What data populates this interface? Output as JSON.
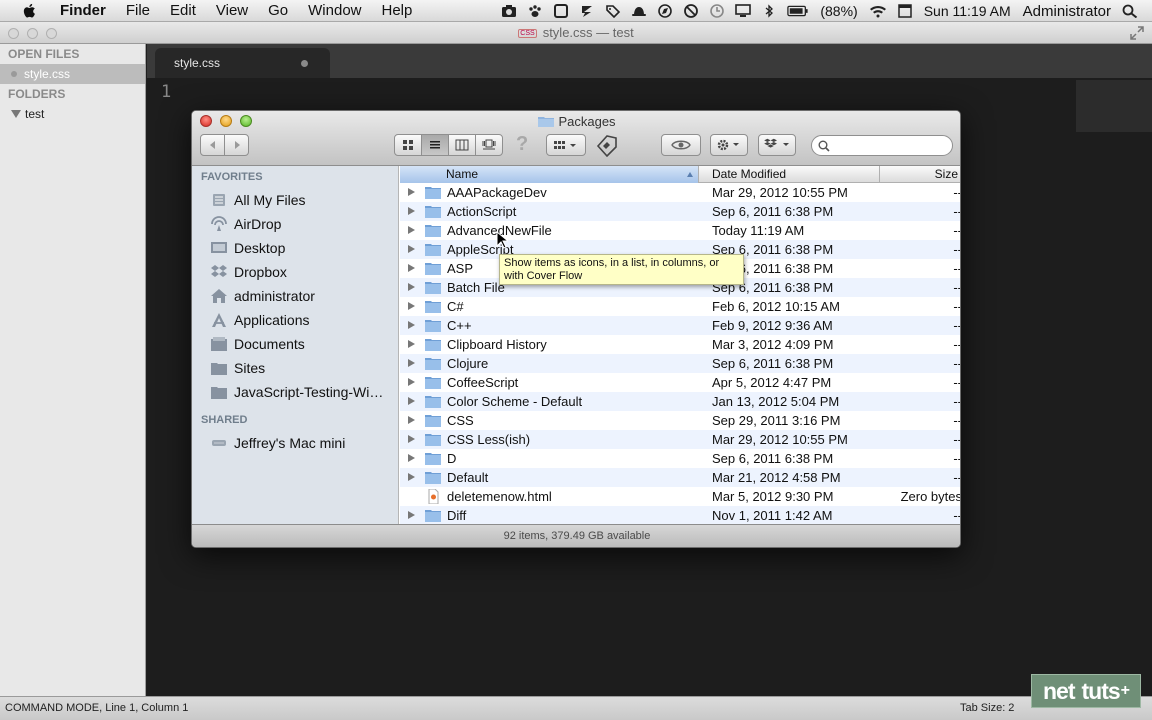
{
  "menubar": {
    "app_name": "Finder",
    "menus": [
      "File",
      "Edit",
      "View",
      "Go",
      "Window",
      "Help"
    ],
    "battery": "(88%)",
    "clock": "Sun 11:19 AM",
    "user": "Administrator"
  },
  "sublime": {
    "window_title": "style.css — test",
    "title_badge": "CSS",
    "sidebar": {
      "open_files_header": "OPEN FILES",
      "open_file": "style.css",
      "folders_header": "FOLDERS",
      "folder": "test"
    },
    "tab_label": "style.css",
    "line_number": "1",
    "status_left": "COMMAND MODE, Line 1, Column 1",
    "status_right": "Tab Size: 2"
  },
  "watermark": {
    "left": "net",
    "right": "tuts",
    "plus": "+"
  },
  "finder": {
    "title": "Packages",
    "sidebar": {
      "favorites_header": "FAVORITES",
      "favorites": [
        {
          "label": "All My Files",
          "icon": "all-files-icon"
        },
        {
          "label": "AirDrop",
          "icon": "airdrop-icon"
        },
        {
          "label": "Desktop",
          "icon": "desktop-icon"
        },
        {
          "label": "Dropbox",
          "icon": "dropbox-icon"
        },
        {
          "label": "administrator",
          "icon": "home-icon"
        },
        {
          "label": "Applications",
          "icon": "applications-icon"
        },
        {
          "label": "Documents",
          "icon": "documents-icon"
        },
        {
          "label": "Sites",
          "icon": "folder-icon"
        },
        {
          "label": "JavaScript-Testing-Wi…",
          "icon": "folder-icon"
        }
      ],
      "shared_header": "SHARED",
      "shared": [
        {
          "label": "Jeffrey's Mac mini",
          "icon": "computer-icon"
        }
      ]
    },
    "columns": {
      "name": "Name",
      "date": "Date Modified",
      "size": "Size"
    },
    "rows": [
      {
        "name": "AAAPackageDev",
        "date": "Mar 29, 2012 10:55 PM",
        "size": "--",
        "type": "folder"
      },
      {
        "name": "ActionScript",
        "date": "Sep 6, 2011 6:38 PM",
        "size": "--",
        "type": "folder"
      },
      {
        "name": "AdvancedNewFile",
        "date": "Today 11:19 AM",
        "size": "--",
        "type": "folder"
      },
      {
        "name": "AppleScript",
        "date": "Sep 6, 2011 6:38 PM",
        "size": "--",
        "type": "folder"
      },
      {
        "name": "ASP",
        "date": "Sep 6, 2011 6:38 PM",
        "size": "--",
        "type": "folder"
      },
      {
        "name": "Batch File",
        "date": "Sep 6, 2011 6:38 PM",
        "size": "--",
        "type": "folder"
      },
      {
        "name": "C#",
        "date": "Feb 6, 2012 10:15 AM",
        "size": "--",
        "type": "folder"
      },
      {
        "name": "C++",
        "date": "Feb 9, 2012 9:36 AM",
        "size": "--",
        "type": "folder"
      },
      {
        "name": "Clipboard History",
        "date": "Mar 3, 2012 4:09 PM",
        "size": "--",
        "type": "folder"
      },
      {
        "name": "Clojure",
        "date": "Sep 6, 2011 6:38 PM",
        "size": "--",
        "type": "folder"
      },
      {
        "name": "CoffeeScript",
        "date": "Apr 5, 2012 4:47 PM",
        "size": "--",
        "type": "folder"
      },
      {
        "name": "Color Scheme - Default",
        "date": "Jan 13, 2012 5:04 PM",
        "size": "--",
        "type": "folder"
      },
      {
        "name": "CSS",
        "date": "Sep 29, 2011 3:16 PM",
        "size": "--",
        "type": "folder"
      },
      {
        "name": "CSS Less(ish)",
        "date": "Mar 29, 2012 10:55 PM",
        "size": "--",
        "type": "folder"
      },
      {
        "name": "D",
        "date": "Sep 6, 2011 6:38 PM",
        "size": "--",
        "type": "folder"
      },
      {
        "name": "Default",
        "date": "Mar 21, 2012 4:58 PM",
        "size": "--",
        "type": "folder"
      },
      {
        "name": "deletemenow.html",
        "date": "Mar 5, 2012 9:30 PM",
        "size": "Zero bytes",
        "type": "file"
      },
      {
        "name": "Diff",
        "date": "Nov 1, 2011 1:42 AM",
        "size": "--",
        "type": "folder"
      }
    ],
    "status": "92 items, 379.49 GB available",
    "tooltip": "Show items as icons, in a list, in columns, or with Cover Flow",
    "search_placeholder": ""
  },
  "colors": {
    "finder_sidebar_bg": "#dde3ea",
    "row_alt": "#edf3fe",
    "header_sort": "#a6c4ea",
    "tooltip_bg": "#ffffc6",
    "editor_bg": "#1d1d1d"
  }
}
